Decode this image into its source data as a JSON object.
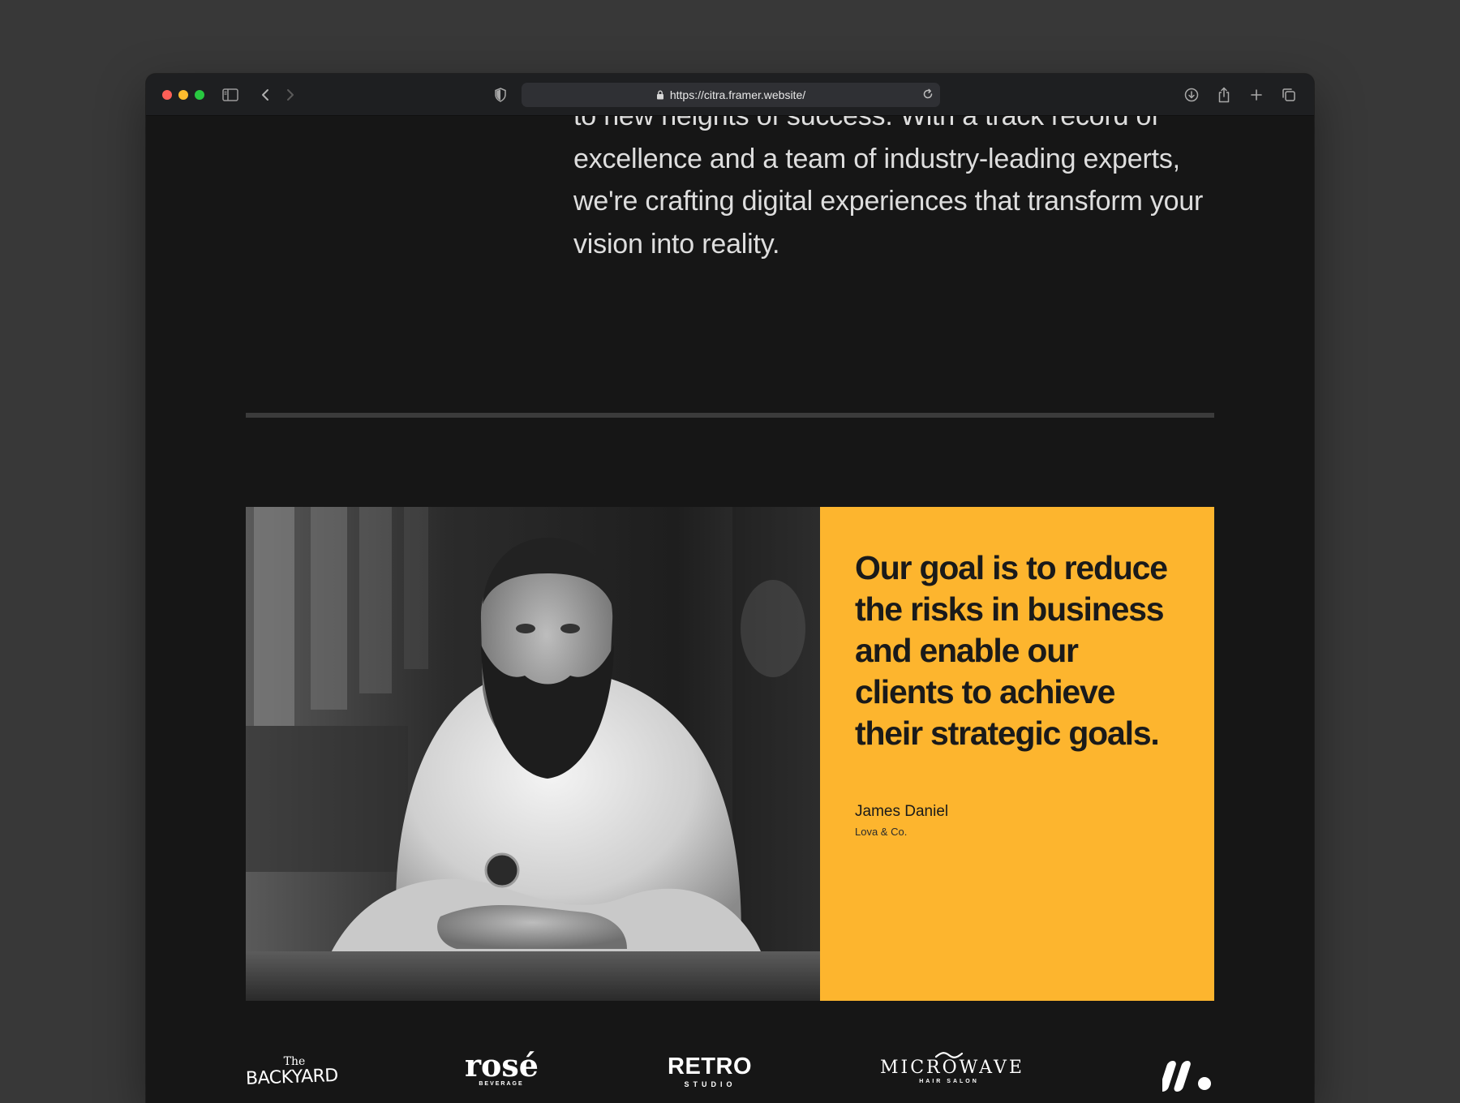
{
  "browser": {
    "url": "https://citra.framer.website/"
  },
  "intro": {
    "paragraph": "to new heights of success. With a track record of excellence and a team of industry-leading experts, we're crafting digital experiences that transform your vision into reality."
  },
  "testimonial": {
    "quote": "Our goal is to reduce the risks in business and enable our clients to achieve their strategic goals.",
    "author_name": "James Daniel",
    "author_company": "Lova & Co.",
    "accent_color": "#fdb52e"
  },
  "logos": [
    {
      "name": "The Backyard",
      "line1": "The",
      "line2": "BACKYARD"
    },
    {
      "name": "rosé beverage",
      "line1": "rosé",
      "line2": "BEVERAGE"
    },
    {
      "name": "Retro Studio",
      "line1": "RETRO",
      "line2": "STUDIO"
    },
    {
      "name": "Microwave Hair Salon",
      "line1": "MICROWAVE",
      "line2": "HAIR SALON"
    },
    {
      "name": "M logo mark"
    }
  ]
}
